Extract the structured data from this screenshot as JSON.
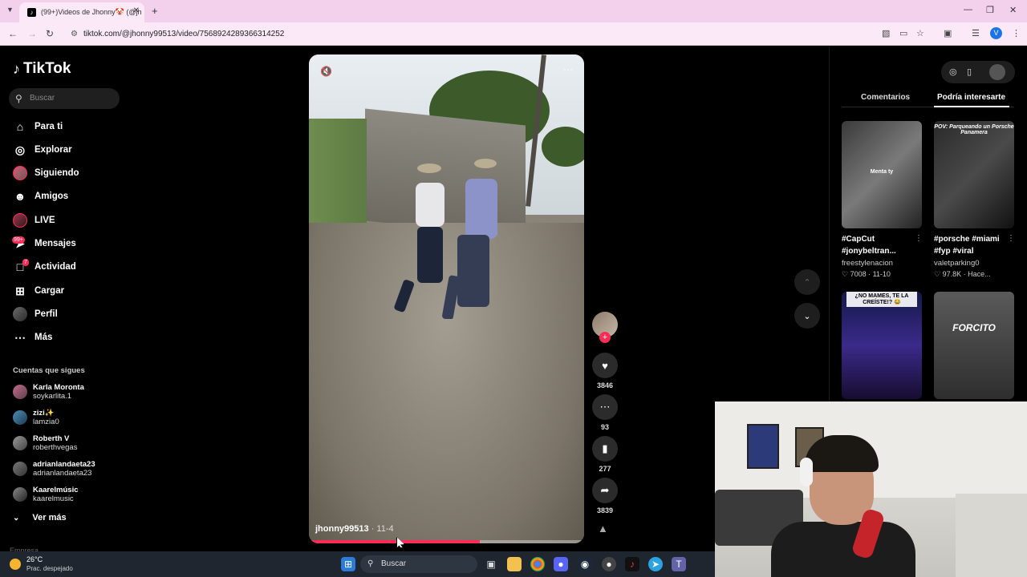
{
  "browser": {
    "tab_title": "(99+)Videos de Jhonny🤡 (@jh",
    "url": "tiktok.com/@jhonny99513/video/7568924289366314252",
    "profile_initial": "V"
  },
  "sidebar": {
    "logo": "TikTok",
    "search_placeholder": "Buscar",
    "nav": [
      {
        "label": "Para ti"
      },
      {
        "label": "Explorar"
      },
      {
        "label": "Siguiendo"
      },
      {
        "label": "Amigos"
      },
      {
        "label": "LIVE"
      },
      {
        "label": "Mensajes",
        "badge": "99+"
      },
      {
        "label": "Actividad",
        "badge": "7"
      },
      {
        "label": "Cargar"
      },
      {
        "label": "Perfil"
      },
      {
        "label": "Más"
      }
    ],
    "following_title": "Cuentas que sigues",
    "following": [
      {
        "name": "Karla Moronta",
        "user": "soykarlita.1"
      },
      {
        "name": "zizi✨",
        "user": "lamzia0"
      },
      {
        "name": "Roberth V",
        "user": "roberthvegas"
      },
      {
        "name": "adrianlandaeta23",
        "user": "adrianlandaeta23"
      },
      {
        "name": "Kaarelmúsic",
        "user": "kaarelmusic"
      }
    ],
    "see_more": "Ver más",
    "footer": "Empresa"
  },
  "video": {
    "username": "jhonny99513",
    "date": " · 11-4",
    "progress": 0.62
  },
  "actions": {
    "likes": "3846",
    "comments": "93",
    "saves": "277",
    "shares": "3839"
  },
  "right_panel": {
    "tab_comments": "Comentarios",
    "tab_suggested": "Podría interesarte",
    "videos": [
      {
        "title": "#CapCut #jonybeltran...",
        "author": "freestylenacion",
        "likes": "♡ 7008 · 11-10",
        "overlay": "Menta ty"
      },
      {
        "title": "#porsche #miami #fyp #viral",
        "author": "valetparking0",
        "likes": "♡ 97.8K · Hace...",
        "overlay": "POV: Parqueando un Porsche Panamera"
      },
      {
        "title": "",
        "author": "",
        "likes": "",
        "overlay": "¿NO MAMES, TE LA CREÍSTE!? 😂"
      },
      {
        "title": "",
        "author": "",
        "likes": "",
        "overlay": "FORCITO"
      }
    ]
  },
  "taskbar": {
    "temperature": "26°C",
    "weather": "Prac. despejado",
    "search": "Buscar"
  }
}
